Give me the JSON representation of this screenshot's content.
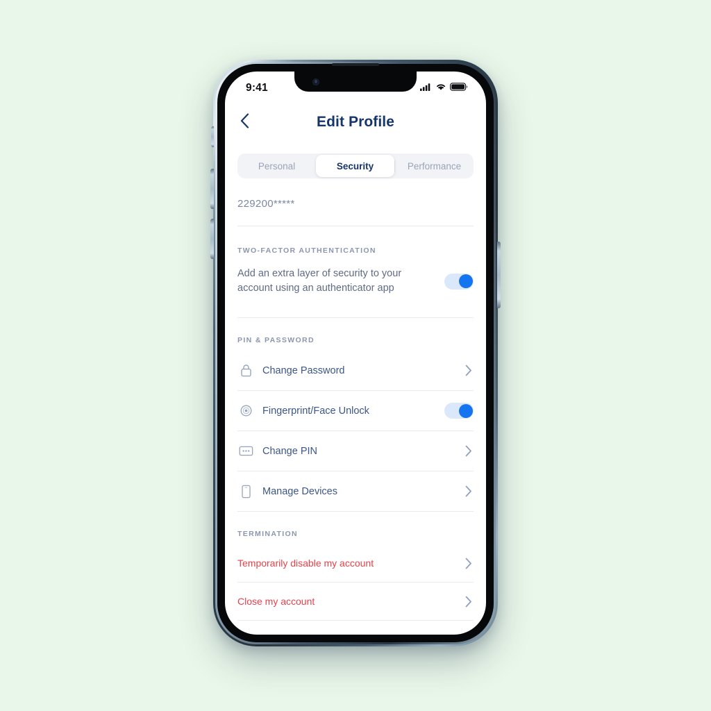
{
  "background_color": "#e9f7ea",
  "status_bar": {
    "time": "9:41",
    "icons": [
      "cellular-signal-icon",
      "wifi-icon",
      "battery-icon"
    ]
  },
  "nav": {
    "back_icon": "chevron-left-icon",
    "title": "Edit Profile"
  },
  "tabs": {
    "items": [
      {
        "label": "Personal",
        "active": false
      },
      {
        "label": "Security",
        "active": true
      },
      {
        "label": "Performance",
        "active": false
      }
    ]
  },
  "account": {
    "masked_value": "229200*****"
  },
  "two_factor": {
    "section_label": "TWO-FACTOR AUTHENTICATION",
    "description": "Add an extra layer of security to your account using an authenticator app",
    "toggle_on": true
  },
  "pin_password": {
    "section_label": "PIN & PASSWORD",
    "rows": [
      {
        "label": "Change Password",
        "icon": "lock-icon",
        "control": "chevron"
      },
      {
        "label": "Fingerprint/Face Unlock",
        "icon": "fingerprint-icon",
        "control": "toggle",
        "toggle_on": true
      },
      {
        "label": "Change PIN",
        "icon": "pin-pad-icon",
        "control": "chevron"
      },
      {
        "label": "Manage Devices",
        "icon": "device-icon",
        "control": "chevron"
      }
    ]
  },
  "termination": {
    "section_label": "TERMINATION",
    "rows": [
      {
        "label": "Temporarily disable my account",
        "control": "chevron"
      },
      {
        "label": "Close my account",
        "control": "chevron"
      }
    ]
  },
  "colors": {
    "title_navy": "#16356d",
    "label_slate": "#3c5687",
    "muted": "#8b96ae",
    "accent_blue": "#1574f0",
    "toggle_track": "#dbe8fb",
    "danger_red": "#e8414a",
    "divider": "#e8eaef"
  }
}
